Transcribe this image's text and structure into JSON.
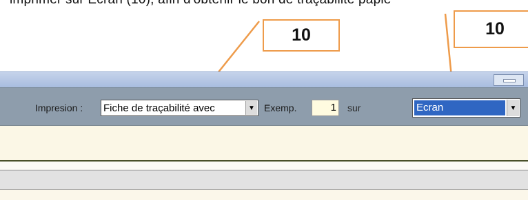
{
  "document": {
    "text_line": "imprimer sur Ecran (10), afin d'obtenir le bon de traçabilité papie"
  },
  "callouts": [
    {
      "label": "10"
    },
    {
      "label": "10"
    }
  ],
  "toolbar": {
    "impression_label": "Impresion :",
    "impression_value": "Fiche de traçabilité avec",
    "exemp_label": "Exemp.",
    "exemp_value": "1",
    "sur_label": "sur",
    "output_value": "Ecran"
  },
  "colors": {
    "callout_border": "#ee9b4a",
    "toolbar_bg": "#8e9dac",
    "selection_bg": "#2f66c2",
    "panel_cream": "#fbf7e6"
  },
  "icons": {
    "dropdown": "chevron-down-icon",
    "minimize": "minimize-icon"
  }
}
